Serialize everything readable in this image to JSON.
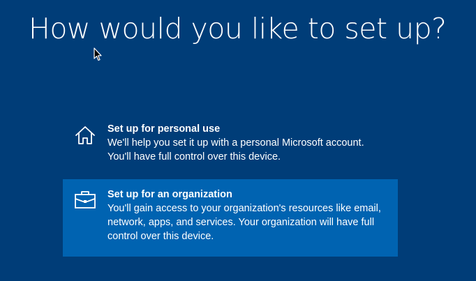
{
  "page": {
    "title": "How would you like to set up?"
  },
  "options": [
    {
      "title": "Set up for personal use",
      "description_lines": [
        "We'll help you set it up with a personal Microsoft account.",
        "You'll have full control over this device."
      ],
      "icon": "home-icon",
      "selected": false
    },
    {
      "title": "Set up for an organization",
      "description_lines": [
        "You'll gain access to your organization's resources like email,",
        "network, apps, and services. Your organization will have full",
        "control over this device."
      ],
      "icon": "briefcase-icon",
      "selected": true
    }
  ],
  "colors": {
    "background": "#003d78",
    "selected_background": "#0063b1",
    "text": "#ffffff"
  }
}
